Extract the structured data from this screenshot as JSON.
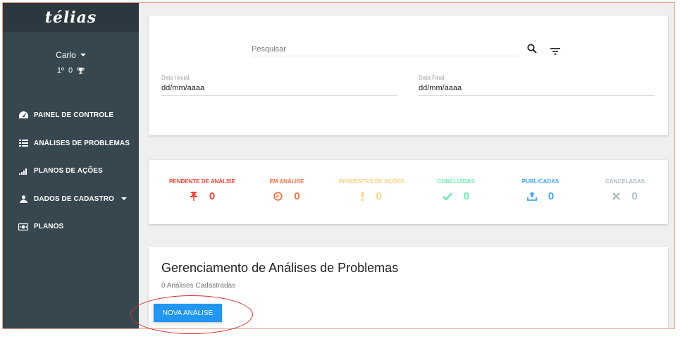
{
  "brand": {
    "logo": "télias"
  },
  "user": {
    "name": "Carlo",
    "rank": "1º",
    "score": "0"
  },
  "nav": [
    {
      "label": "PAINEL DE CONTROLE",
      "icon": "dashboard-icon"
    },
    {
      "label": "ANÁLISES DE PROBLEMAS",
      "icon": "list-icon"
    },
    {
      "label": "PLANOS DE AÇÕES",
      "icon": "signal-bars-icon"
    },
    {
      "label": "DADOS DE CADASTRO",
      "icon": "user-icon"
    },
    {
      "label": "PLANOS",
      "icon": "money-icon"
    }
  ],
  "filters": {
    "search_placeholder": "Pesquisar",
    "start_label": "Data Inicial",
    "start_value": "dd/mm/aaaa",
    "end_label": "Data Final",
    "end_value": "dd/mm/aaaa"
  },
  "statuses": [
    {
      "label": "PENDENTE DE ANÁLISE",
      "count": "0",
      "color": "#f44336",
      "icon": "pin-icon"
    },
    {
      "label": "EM ANÁLISE",
      "count": "0",
      "color": "#ff7043",
      "icon": "clock-icon"
    },
    {
      "label": "PENDENTES DE AÇÕES",
      "count": "0",
      "color": "#ffd180",
      "icon": "exclamation-icon"
    },
    {
      "label": "CONCLUÍDAS",
      "count": "0",
      "color": "#69f0ae",
      "icon": "check-icon"
    },
    {
      "label": "PUBLICADAS",
      "count": "0",
      "color": "#42a5f5",
      "icon": "upload-icon"
    },
    {
      "label": "CANCELADAS",
      "count": "0",
      "color": "#b0bec5",
      "icon": "cancel-icon"
    }
  ],
  "manage": {
    "title": "Gerenciamento de Análises de Problemas",
    "count": "0 Análises Cadastradas",
    "new_button": "NOVA ANÁLISE"
  }
}
